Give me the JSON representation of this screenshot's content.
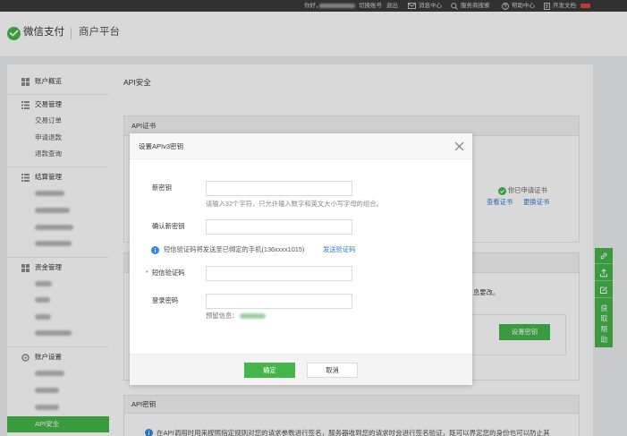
{
  "colors": {
    "accent": "#44b549",
    "link": "#2e7ad6",
    "required": "#e64340",
    "info": "#2e8ae6",
    "topbar_bg": "#3a3a3a",
    "overlay": "rgba(0,0,0,0.15)"
  },
  "topbar": {
    "greeting": "你好，",
    "switch_account": "切换账号",
    "logout": "退出",
    "messages": {
      "icon": "mail-icon",
      "label": "消息中心"
    },
    "provider_search": {
      "icon": "search-icon",
      "label": "服务商搜索"
    },
    "help_center": {
      "icon": "help-icon",
      "label": "帮助中心"
    },
    "dev_docs": {
      "icon": "document-icon",
      "label": "开发文档"
    }
  },
  "header": {
    "brand": "微信支付",
    "platform": "商户平台"
  },
  "sidebar": {
    "overview": {
      "icon": "grid-icon",
      "label": "账户概览"
    },
    "trade": {
      "icon": "list-icon",
      "label": "交易管理",
      "items": [
        "交易订单",
        "申请退款",
        "退款查询"
      ]
    },
    "settlement": {
      "icon": "list-icon",
      "label": "结算管理"
    },
    "funds": {
      "icon": "grid-icon",
      "label": "资金管理"
    },
    "account_settings": {
      "icon": "settings-icon",
      "label": "账户设置",
      "active_item": "API安全"
    }
  },
  "main": {
    "page_title": "API安全",
    "cert_panel": {
      "title": "API证书",
      "status": "你已申请证书",
      "view_link": "查看证书",
      "replace_link": "更换证书"
    },
    "key_panel": {
      "visible_text": "息要改。",
      "button": "设置密钥"
    },
    "apikey_panel": {
      "title": "API密钥",
      "description": "在API调用时用来按照指定规则对您的请求参数进行签名，服务器收到您的请求时会进行签名验证，既可以界定您的身份也可以防止其"
    }
  },
  "help_toolbar": {
    "icons": [
      "link-icon",
      "upload-icon",
      "edit-icon"
    ],
    "label": "获取帮助"
  },
  "modal": {
    "title": "设置APIv3密钥",
    "new_key_label": "新密钥",
    "new_key_hint": "请输入32个字符，只允许输入数字和英文大小写字母的组合。",
    "confirm_key_label": "确认新密钥",
    "sms_notice": "短信验证码将发送至已绑定的手机(136xxxx1015)",
    "send_code_link": "发送验证码",
    "required_mark": "*",
    "sms_code_label": "短信验证码",
    "login_password_label": "登录密码",
    "reserved_info_label": "预留信息：",
    "confirm_button": "确定",
    "cancel_button": "取消"
  }
}
